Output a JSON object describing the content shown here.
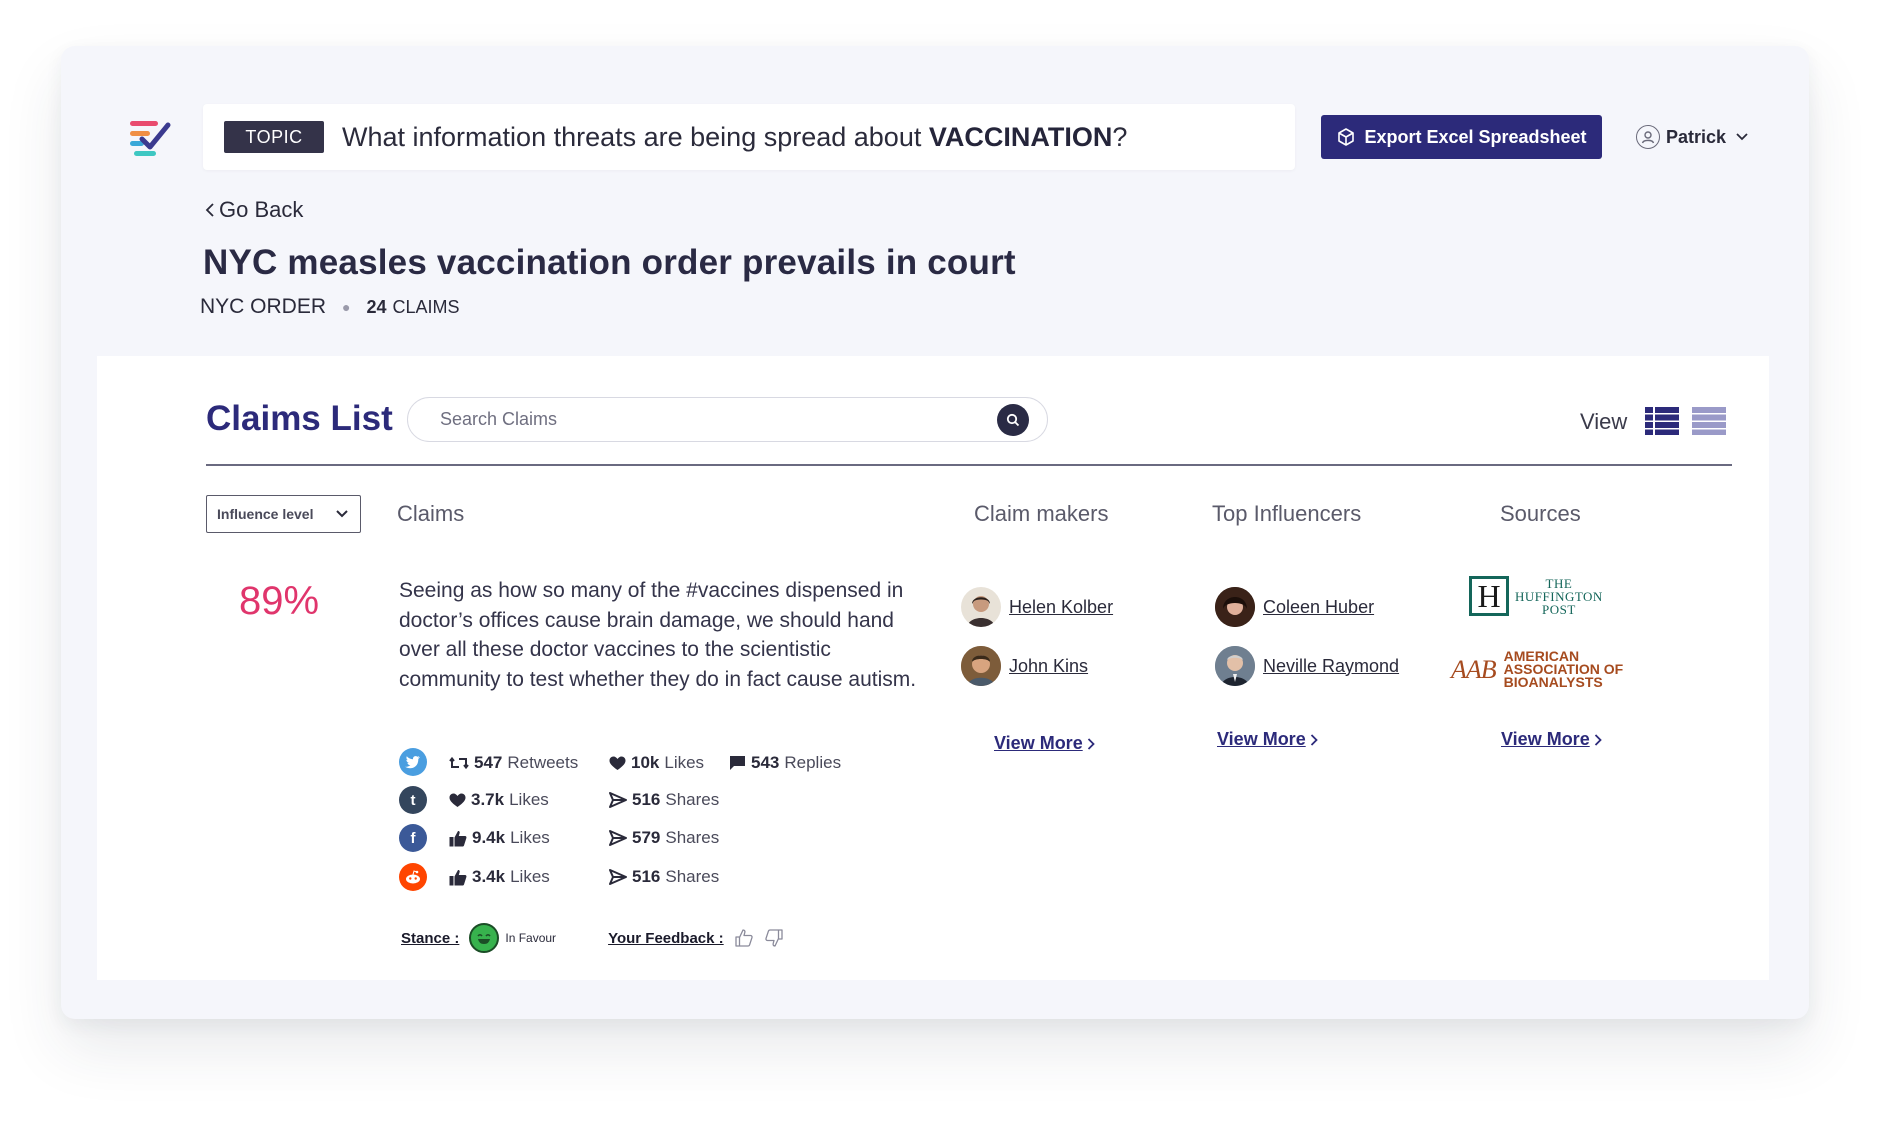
{
  "header": {
    "topic_badge": "TOPIC",
    "topic_question_prefix": "What information threats are being spread about ",
    "topic_keyword": "VACCINATION",
    "topic_question_suffix": "?",
    "export_label": "Export Excel Spreadsheet",
    "user_name": "Patrick"
  },
  "page": {
    "go_back": "Go Back",
    "title": "NYC measles vaccination order prevails in court",
    "category": "NYC ORDER",
    "claims_count": "24",
    "claims_count_label": "CLAIMS"
  },
  "claims_list": {
    "title": "Claims List",
    "search_placeholder": "Search Claims",
    "view_label": "View",
    "filter_label": "Influence level",
    "columns": {
      "claims": "Claims",
      "claim_makers": "Claim makers",
      "top_influencers": "Top Influencers",
      "sources": "Sources"
    }
  },
  "claim": {
    "influence_pct": "89%",
    "text": "Seeing as how so many of the #vaccines dispensed in doctor’s offices cause brain damage, we should hand over all these doctor vaccines to the scientistic community to test whether they do in fact cause autism.",
    "stats": {
      "twitter": {
        "retweets_value": "547",
        "retweets_label": "Retweets",
        "likes_value": "10k",
        "likes_label": "Likes",
        "replies_value": "543",
        "replies_label": "Replies"
      },
      "tumblr": {
        "likes_value": "3.7k",
        "likes_label": "Likes",
        "shares_value": "516",
        "shares_label": "Shares"
      },
      "facebook": {
        "likes_value": "9.4k",
        "likes_label": "Likes",
        "shares_value": "579",
        "shares_label": "Shares"
      },
      "reddit": {
        "likes_value": "3.4k",
        "likes_label": "Likes",
        "shares_value": "516",
        "shares_label": "Shares"
      }
    },
    "stance_label": "Stance :",
    "stance_value": "In Favour",
    "feedback_label": "Your Feedback :",
    "claim_makers": [
      "Helen Kolber",
      "John Kins"
    ],
    "top_influencers": [
      "Coleen Huber",
      "Neville Raymond"
    ],
    "sources": {
      "huffington": {
        "letter": "H",
        "line1": "THE",
        "line2": "HUFFINGTON",
        "line3": "POST"
      },
      "aab": {
        "mark": "AAB",
        "line1": "AMERICAN",
        "line2": "ASSOCIATION OF",
        "line3": "BIOANALYSTS"
      }
    },
    "view_more": "View More"
  },
  "colors": {
    "brand": "#2c2a7a",
    "accent_pink": "#e0356c",
    "twitter": "#4a9ee0",
    "tumblr": "#34465d",
    "facebook": "#3b5998",
    "reddit": "#ff4500",
    "stance_green": "#37b24d"
  },
  "icons": [
    "logo-icon",
    "export-box-icon",
    "user-avatar-icon",
    "chevron-down-icon",
    "chevron-left-icon",
    "search-icon",
    "list-view-icon",
    "grid-view-icon",
    "twitter-icon",
    "tumblr-icon",
    "facebook-icon",
    "reddit-icon",
    "retweet-icon",
    "heart-icon",
    "comment-icon",
    "thumbs-up-icon",
    "share-icon",
    "smiley-icon",
    "thumbs-down-icon",
    "chevron-right-icon"
  ]
}
